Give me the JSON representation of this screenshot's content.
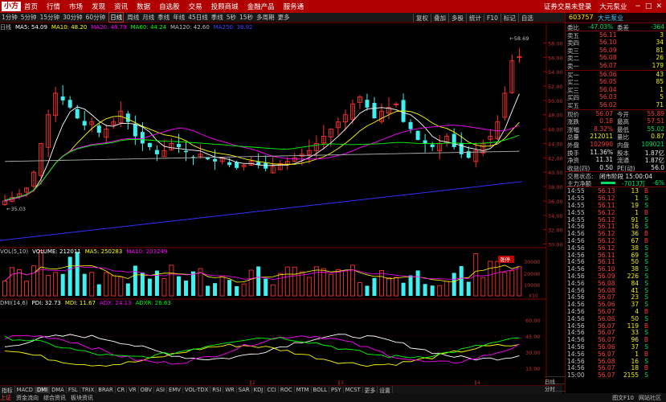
{
  "top_menu": {
    "logo": "小方",
    "items": [
      "首页",
      "行情",
      "市场",
      "发现",
      "资讯",
      "数据",
      "自选股",
      "交易",
      "投顾商城",
      "金融产品",
      "服务通"
    ],
    "right_items": [
      "证券交易未登录",
      "大元泵业"
    ]
  },
  "period_bar": {
    "items": [
      "1分钟",
      "5分钟",
      "15分钟",
      "30分钟",
      "60分钟",
      "日线",
      "周线",
      "月线",
      "季线",
      "年线",
      "45日线",
      "季线",
      "5秒",
      "15秒",
      "多周期",
      "更多"
    ],
    "active": "日线",
    "right_buttons": [
      "复权",
      "叠加",
      "多股",
      "统计",
      "F10",
      "标记",
      "自选"
    ]
  },
  "price_panel": {
    "header": [
      {
        "text": "日线",
        "color": "#c0c0c0"
      },
      {
        "text": "MA5: 54.09",
        "color": "#ffffff"
      },
      {
        "text": "MA10: 48.20",
        "color": "#ffff00"
      },
      {
        "text": "MA20: 48.79",
        "color": "#ff00ff"
      },
      {
        "text": "MA60: 44.24",
        "color": "#00ff00"
      },
      {
        "text": "MA120: 42.60",
        "color": "#c0c0c0"
      },
      {
        "text": "MA250: 38.92",
        "color": "#4040ff"
      }
    ],
    "y_ticks": [
      "58.00",
      "56.00",
      "54.00",
      "52.00",
      "50.00",
      "48.00",
      "46.00",
      "44.00",
      "42.00",
      "40.00",
      "38.00",
      "36.00",
      "34.00",
      "32.00",
      "30.00"
    ],
    "high_label": "58.69",
    "low_label": "35.03",
    "tag": "涨停"
  },
  "volume_panel": {
    "header": [
      {
        "text": "VOL(5,10)",
        "color": "#c0c0c0"
      },
      {
        "text": "VOLUME: 212011",
        "color": "#ffffff"
      },
      {
        "text": "MA5: 250283",
        "color": "#ffff00"
      },
      {
        "text": "MA10: 203249",
        "color": "#ff00ff"
      }
    ],
    "y_ticks": [
      "30000",
      "20000",
      "10000"
    ],
    "unit": "X10"
  },
  "dmi_panel": {
    "header": [
      {
        "text": "DMI(14,6)",
        "color": "#c0c0c0"
      },
      {
        "text": "PDI: 32.73",
        "color": "#ffffff"
      },
      {
        "text": "MDI: 11.67",
        "color": "#ffff00"
      },
      {
        "text": "ADX: 24.13",
        "color": "#ff00ff"
      },
      {
        "text": "ADXR: 26.63",
        "color": "#00ff00"
      }
    ],
    "y_ticks": [
      "60.00",
      "45.00",
      "30.00",
      "15.00"
    ],
    "month_marks": [
      "2",
      "3",
      "4"
    ]
  },
  "indicator_tabs": [
    "指标",
    "MACD",
    "DMI",
    "DMA",
    "FSL",
    "TRIX",
    "BRAR",
    "CR",
    "VR",
    "OBV",
    "ASI",
    "EMV",
    "VOL-TDX",
    "RSI",
    "WR",
    "SAR",
    "KDJ",
    "CCI",
    "ROC",
    "MTM",
    "BOLL",
    "PSY",
    "MCST",
    "更多",
    "设置"
  ],
  "indicator_active": "DMI",
  "panel_tabs": [
    "日线",
    "分时",
    "模板"
  ],
  "status_bar": [
    "上证",
    "资金流向",
    "综合资讯",
    "板块资讯"
  ],
  "status_right": [
    "图文F10",
    "网站社区"
  ],
  "quote": {
    "code": "603757",
    "name": "大元泵业",
    "weibi_label": "委比",
    "weibi_value": "-47.03%",
    "weicha_label": "委差",
    "weicha_value": "-364",
    "asks": [
      {
        "label": "卖五",
        "price": "56.11",
        "vol": "3"
      },
      {
        "label": "卖四",
        "price": "56.10",
        "vol": "34"
      },
      {
        "label": "卖三",
        "price": "56.09",
        "vol": "81"
      },
      {
        "label": "卖二",
        "price": "56.08",
        "vol": "26"
      },
      {
        "label": "卖一",
        "price": "56.07",
        "vol": "179"
      }
    ],
    "bids": [
      {
        "label": "买一",
        "price": "56.06",
        "vol": "43"
      },
      {
        "label": "买二",
        "price": "56.05",
        "vol": "85"
      },
      {
        "label": "买三",
        "price": "56.04",
        "vol": "1"
      },
      {
        "label": "买四",
        "price": "56.03",
        "vol": "5"
      },
      {
        "label": "买五",
        "price": "56.02",
        "vol": "71"
      }
    ],
    "stats": [
      {
        "l1": "现价",
        "v1": "56.07",
        "l2": "今开",
        "v2": "55.89",
        "c1": "#ff3b3b",
        "c2": "#ff3b3b"
      },
      {
        "l1": "涨跌",
        "v1": "0.18",
        "l2": "最高",
        "v2": "57.51",
        "c1": "#ff3b3b",
        "c2": "#ff3b3b"
      },
      {
        "l1": "涨幅",
        "v1": "8.32%",
        "l2": "最低",
        "v2": "55.02",
        "c1": "#ff3b3b",
        "c2": "#00e060"
      },
      {
        "l1": "总量",
        "v1": "212011",
        "l2": "量比",
        "v2": "0.87",
        "c1": "#f0f000",
        "c2": "#f0f000"
      },
      {
        "l1": "外盘",
        "v1": "102990",
        "l2": "内盘",
        "v2": "109021",
        "c1": "#ff3b3b",
        "c2": "#00e060"
      },
      {
        "l1": "换手",
        "v1": "11.36%",
        "l2": "股本",
        "v2": "1.87亿",
        "c1": "#e8e8e8",
        "c2": "#e8e8e8"
      },
      {
        "l1": "净资",
        "v1": "11.31",
        "l2": "流通",
        "v2": "1.87亿",
        "c1": "#e8e8e8",
        "c2": "#e8e8e8"
      },
      {
        "l1": "收益(四)",
        "v1": "0.50",
        "l2": "PE(动)",
        "v2": "56.0",
        "c1": "#e8e8e8",
        "c2": "#e8e8e8"
      }
    ],
    "status_label": "交易状态:",
    "status_value": "闭市阶段 15:00:04",
    "net_label": "主力净额",
    "net_value": "-7013万",
    "net_pct": "-6%"
  },
  "ticks": [
    {
      "t": "14:55",
      "p": "56.13",
      "v": "13",
      "d": "B"
    },
    {
      "t": "14:55",
      "p": "56.12",
      "v": "1",
      "d": "S"
    },
    {
      "t": "14:55",
      "p": "56.11",
      "v": "19",
      "d": "S"
    },
    {
      "t": "14:55",
      "p": "56.12",
      "v": "1",
      "d": "B"
    },
    {
      "t": "14:55",
      "p": "56.12",
      "v": "91",
      "d": "S"
    },
    {
      "t": "14:56",
      "p": "56.11",
      "v": "16",
      "d": "S"
    },
    {
      "t": "14:56",
      "p": "56.12",
      "v": "36",
      "d": "B"
    },
    {
      "t": "14:56",
      "p": "56.12",
      "v": "67",
      "d": "B"
    },
    {
      "t": "14:56",
      "p": "56.12",
      "v": "38",
      "d": "S"
    },
    {
      "t": "14:56",
      "p": "56.11",
      "v": "69",
      "d": "S"
    },
    {
      "t": "14:56",
      "p": "56.11",
      "v": "50",
      "d": "S"
    },
    {
      "t": "14:56",
      "p": "56.10",
      "v": "38",
      "d": "S"
    },
    {
      "t": "14:56",
      "p": "56.09",
      "v": "226",
      "d": "S"
    },
    {
      "t": "14:56",
      "p": "56.08",
      "v": "84",
      "d": "S"
    },
    {
      "t": "14:56",
      "p": "56.08",
      "v": "41",
      "d": "S"
    },
    {
      "t": "14:56",
      "p": "56.07",
      "v": "23",
      "d": "S"
    },
    {
      "t": "14:56",
      "p": "56.06",
      "v": "37",
      "d": "S"
    },
    {
      "t": "14:56",
      "p": "56.07",
      "v": "4",
      "d": "B"
    },
    {
      "t": "14:56",
      "p": "56.06",
      "v": "50",
      "d": "S"
    },
    {
      "t": "14:56",
      "p": "56.07",
      "v": "119",
      "d": "B"
    },
    {
      "t": "14:56",
      "p": "56.07",
      "v": "33",
      "d": "S"
    },
    {
      "t": "14:56",
      "p": "56.07",
      "v": "96",
      "d": "B"
    },
    {
      "t": "14:56",
      "p": "56.06",
      "v": "37",
      "d": "S"
    },
    {
      "t": "14:56",
      "p": "56.07",
      "v": "1",
      "d": "B"
    },
    {
      "t": "14:56",
      "p": "56.08",
      "v": "16",
      "d": "S"
    },
    {
      "t": "14:56",
      "p": "56.07",
      "v": "18",
      "d": "B"
    },
    {
      "t": "15:00",
      "p": "56.07",
      "v": "2155",
      "d": "S"
    }
  ]
}
